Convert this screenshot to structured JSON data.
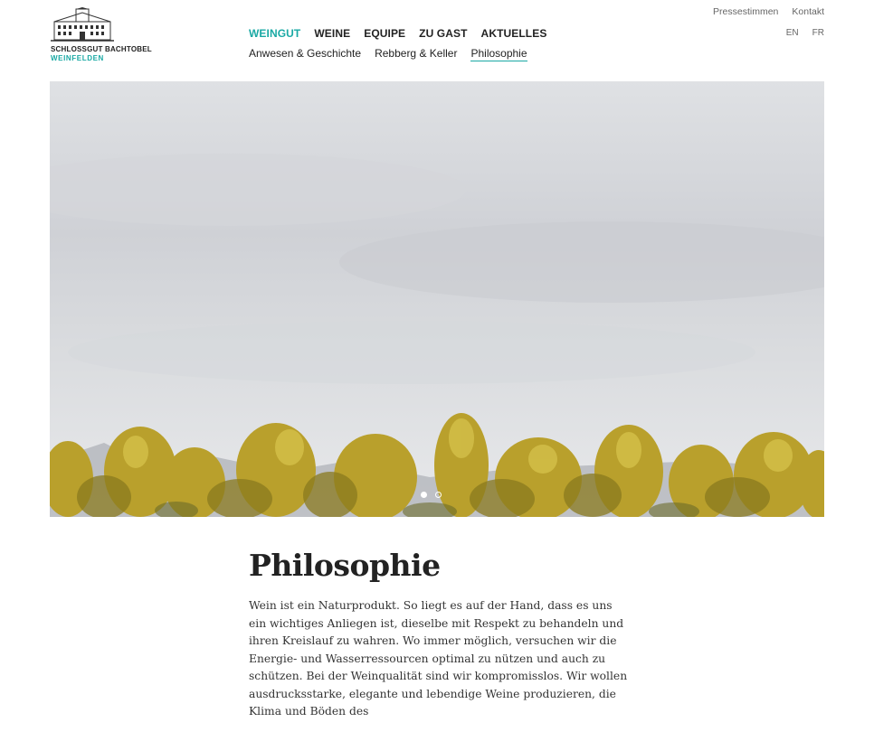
{
  "brand": {
    "line1": "SCHLOSSGUT BACHTOBEL",
    "line2": "WEINFELDEN",
    "logo_icon": "castle-icon"
  },
  "nav": {
    "main": [
      "WEINGUT",
      "WEINE",
      "EQUIPE",
      "ZU GAST",
      "AKTUELLES"
    ],
    "active_main": "WEINGUT",
    "sub": [
      "Anwesen & Geschichte",
      "Rebberg & Keller",
      "Philosophie"
    ],
    "active_sub": "Philosophie"
  },
  "utility": [
    "Pressestimmen",
    "Kontakt"
  ],
  "languages": [
    "EN",
    "FR"
  ],
  "hero": {
    "slide_count": 2,
    "active_slide": 1
  },
  "page": {
    "title": "Philosophie",
    "body": "Wein ist ein Naturprodukt. So liegt es auf der Hand, dass es uns ein wichtiges Anliegen ist, dieselbe mit Respekt zu behandeln und ihren Kreislauf zu wahren. Wo immer möglich, versuchen wir die Energie- und Wasserressourcen optimal zu nützen und auch zu schützen. Bei der Weinqualität sind wir kompromisslos. Wir wollen ausdrucksstarke, elegante und lebendige Weine produzieren, die Klima und Böden des"
  },
  "colors": {
    "accent": "#1aa9a4",
    "text": "#222222",
    "foliage": "#b9a02c"
  }
}
